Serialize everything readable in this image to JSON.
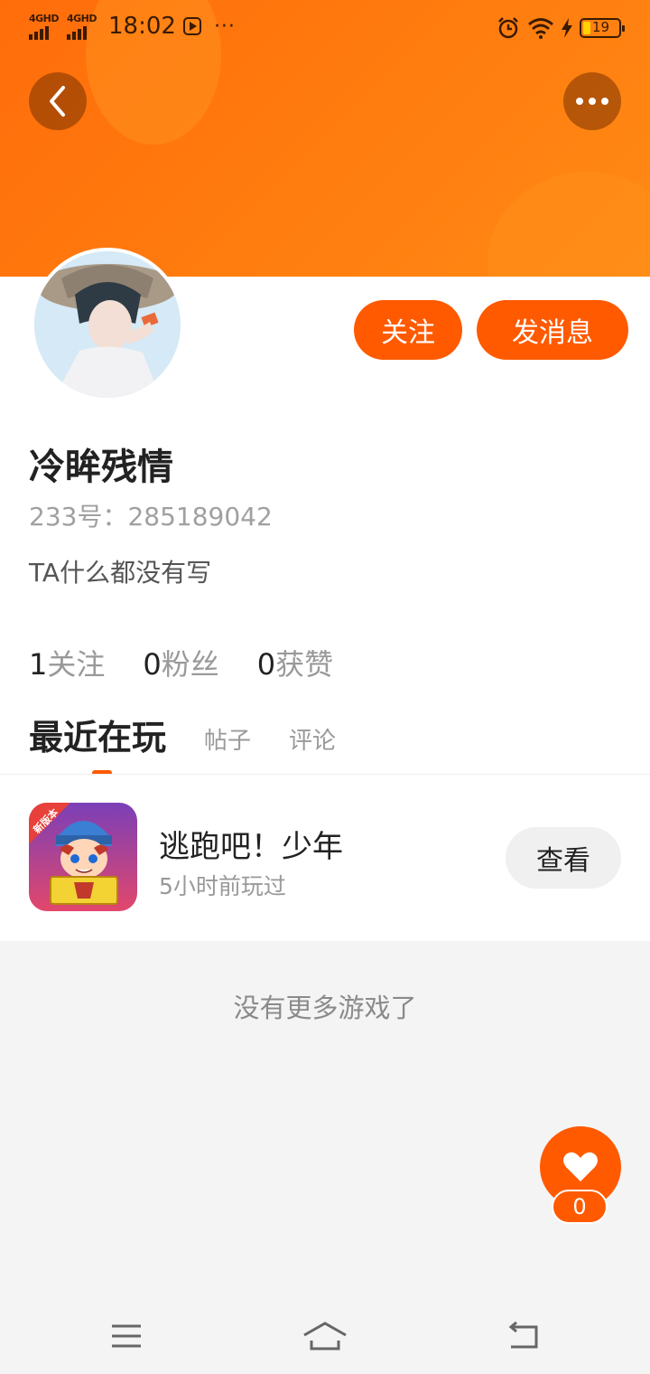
{
  "status_bar": {
    "signal_1": "4GHD",
    "signal_2": "4GHD",
    "time": "18:02",
    "more": "···",
    "battery_level": "19"
  },
  "header": {
    "back_icon": "chevron-left-icon",
    "more_icon": "more-dots-icon"
  },
  "profile": {
    "name": "冷眸残情",
    "id_text": "233号：285189042",
    "bio": "TA什么都没有写",
    "follow_label": "关注",
    "message_label": "发消息",
    "stats": [
      {
        "number": "1",
        "label": "关注"
      },
      {
        "number": "0",
        "label": "粉丝"
      },
      {
        "number": "0",
        "label": "获赞"
      }
    ]
  },
  "tabs": [
    {
      "label": "最近在玩",
      "active": true
    },
    {
      "label": "帖子",
      "active": false
    },
    {
      "label": "评论",
      "active": false
    }
  ],
  "games": [
    {
      "name": "逃跑吧！少年",
      "played": "5小时前玩过",
      "badge": "新版本",
      "action": "查看"
    }
  ],
  "footer_note": "没有更多游戏了",
  "like": {
    "count": "0",
    "icon": "heart-icon"
  },
  "nav": {
    "menu_icon": "menu-icon",
    "home_icon": "home-icon",
    "back_icon": "return-icon"
  },
  "colors": {
    "accent": "#ff5a00",
    "banner": "#ff7a0e"
  }
}
